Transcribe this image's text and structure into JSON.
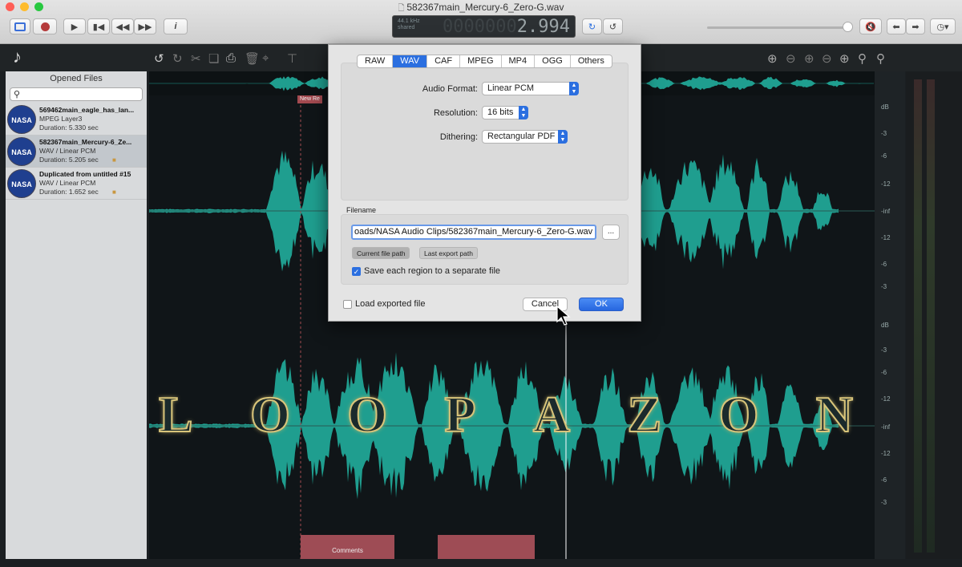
{
  "window": {
    "title": "582367main_Mercury-6_Zero-G.wav",
    "sample_rate": "44.1 kHz",
    "mode": "shared",
    "time_display": "2.994",
    "time_ghost": "0000000"
  },
  "sidebar": {
    "title": "Opened Files",
    "search_placeholder": "",
    "files": [
      {
        "name": "569462main_eagle_has_lan...",
        "type": "MPEG Layer3",
        "duration": "Duration: 5.330 sec",
        "logo": "NASA"
      },
      {
        "name": "582367main_Mercury-6_Ze...",
        "type": "WAV / Linear PCM",
        "duration": "Duration: 5.205 sec",
        "logo": "NASA"
      },
      {
        "name": "Duplicated from untitled #15",
        "type": "WAV / Linear PCM",
        "duration": "Duration: 1.652 sec",
        "logo": "NASA"
      }
    ]
  },
  "marker": {
    "label": "New Re"
  },
  "ruler": {
    "top": [
      "dB",
      "-3",
      "-6",
      "-12",
      "-inf",
      "-12",
      "-6",
      "-3"
    ],
    "bottom": [
      "dB",
      "-3",
      "-6",
      "-12",
      "-inf",
      "-12",
      "-6",
      "-3"
    ]
  },
  "watermark": {
    "letters": [
      "L",
      "O",
      "O",
      "P",
      "A",
      "Z",
      "O",
      "N"
    ]
  },
  "comments": {
    "label": "Comments"
  },
  "export_dialog": {
    "tabs": [
      "RAW",
      "WAV",
      "CAF",
      "MPEG",
      "MP4",
      "OGG",
      "Others"
    ],
    "active_tab": "WAV",
    "fields": {
      "audio_format_label": "Audio Format:",
      "audio_format_value": "Linear PCM",
      "resolution_label": "Resolution:",
      "resolution_value": "16 bits",
      "dithering_label": "Dithering:",
      "dithering_value": "Rectangular PDF"
    },
    "filename_label": "Filename",
    "filename_value": "oads/NASA Audio Clips/582367main_Mercury-6_Zero-G.wav",
    "browse_label": "...",
    "current_path_label": "Current file path",
    "last_path_label": "Last export path",
    "separate_file_label": "Save each region to a separate file",
    "separate_file_checked": true,
    "load_exported_label": "Load exported file",
    "load_exported_checked": false,
    "cancel_label": "Cancel",
    "ok_label": "OK"
  },
  "colors": {
    "waveform": "#1f9e8f",
    "accent": "#2b6fe0",
    "comment_region": "#9e4c55",
    "marker": "#a34a50"
  }
}
